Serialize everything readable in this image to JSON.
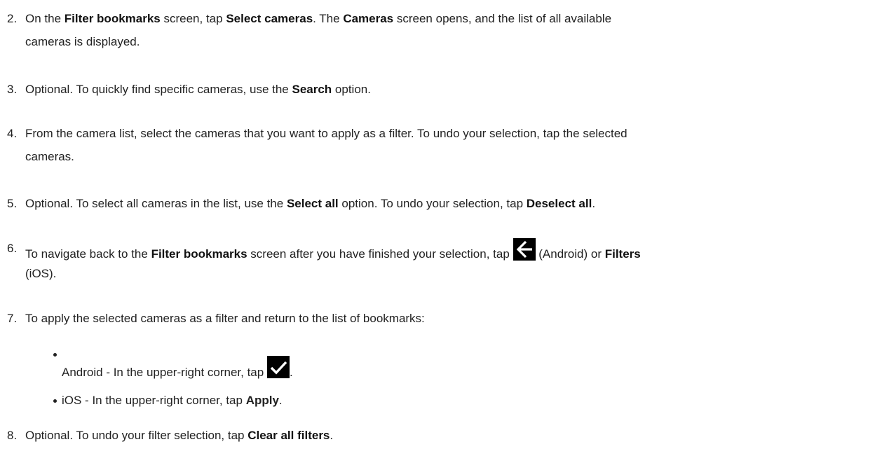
{
  "steps": [
    {
      "num": "2.",
      "parts": [
        {
          "t": "On the "
        },
        {
          "b": "Filter bookmarks"
        },
        {
          "t": " screen, tap "
        },
        {
          "b": "Select cameras"
        },
        {
          "t": ". The "
        },
        {
          "b": "Cameras"
        },
        {
          "t": " screen opens, and the list of all available"
        }
      ],
      "line2": "cameras is displayed."
    },
    {
      "num": "3.",
      "parts": [
        {
          "t": "Optional. To quickly find specific cameras, use the "
        },
        {
          "b": "Search"
        },
        {
          "t": " option."
        }
      ]
    },
    {
      "num": "4.",
      "line1": "From the camera list, select the cameras that you want to apply as a filter. To undo your selection, tap the selected",
      "line2": "cameras."
    },
    {
      "num": "5.",
      "parts": [
        {
          "t": "Optional. To select all cameras in the list, use the "
        },
        {
          "b": "Select all"
        },
        {
          "t": " option. To undo your selection, tap "
        },
        {
          "b": "Deselect all"
        },
        {
          "t": "."
        }
      ]
    },
    {
      "num": "6.",
      "parts": [
        {
          "t": "To navigate back to the "
        },
        {
          "b": "Filter bookmarks"
        },
        {
          "t": " screen after you have finished your selection, tap "
        },
        {
          "icon": "back-arrow-icon"
        },
        {
          "t": " (Android) or "
        },
        {
          "b": "Filters"
        }
      ],
      "line2": "(iOS)."
    },
    {
      "num": "7.",
      "line1": "To apply the selected cameras as a filter and return to the list of bookmarks:"
    },
    {
      "num": "8.",
      "parts": [
        {
          "t": "Optional. To undo your filter selection, tap "
        },
        {
          "b": "Clear all filters"
        },
        {
          "t": "."
        }
      ]
    }
  ],
  "bullets": [
    {
      "parts": [
        {
          "t": "Android - In the upper-right corner, tap "
        },
        {
          "icon": "checkmark-icon"
        },
        {
          "t": "."
        }
      ]
    },
    {
      "parts": [
        {
          "t": "iOS - In the upper-right corner, tap "
        },
        {
          "b": "Apply"
        },
        {
          "t": "."
        }
      ]
    }
  ],
  "colors": {
    "text": "#222222",
    "icon_background": "#000000",
    "icon_glyph": "#ffffff"
  }
}
